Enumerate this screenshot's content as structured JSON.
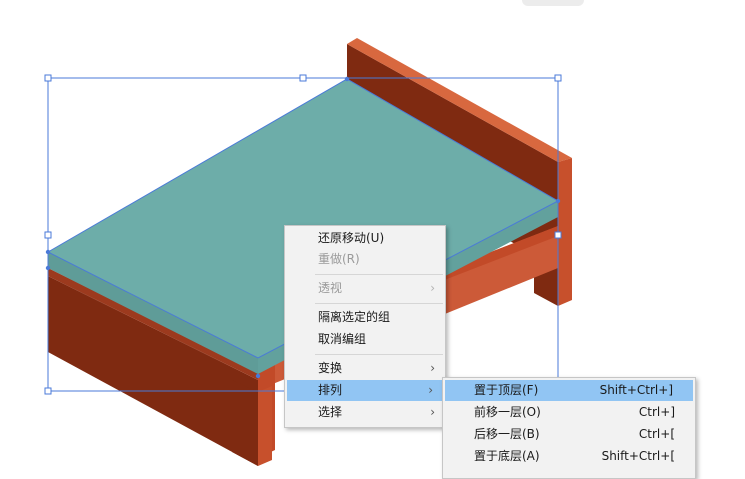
{
  "context_menu": {
    "items": [
      {
        "label": "还原移动(U)",
        "enabled": true
      },
      {
        "label": "重做(R)",
        "enabled": false
      },
      {
        "label": "透视",
        "enabled": false,
        "has_submenu": true
      },
      {
        "label": "隔离选定的组",
        "enabled": true
      },
      {
        "label": "取消编组",
        "enabled": true
      },
      {
        "label": "变换",
        "enabled": true,
        "has_submenu": true
      },
      {
        "label": "排列",
        "enabled": true,
        "has_submenu": true,
        "highlighted": true
      },
      {
        "label": "选择",
        "enabled": true,
        "has_submenu": true
      }
    ],
    "submenu_arrow": "›"
  },
  "arrange_submenu": {
    "items": [
      {
        "label": "置于顶层(F)",
        "shortcut": "Shift+Ctrl+]",
        "highlighted": true
      },
      {
        "label": "前移一层(O)",
        "shortcut": "Ctrl+]"
      },
      {
        "label": "后移一层(B)",
        "shortcut": "Ctrl+["
      },
      {
        "label": "置于底层(A)",
        "shortcut": "Shift+Ctrl+["
      }
    ]
  },
  "colors": {
    "mattress_top": "#6dada9",
    "mattress_side": "#5f9c98",
    "frame_light": "#cc5a38",
    "frame_mid": "#c24a28",
    "frame_dark": "#7f2a11",
    "selection": "#4a7ad8",
    "menu_bg": "#f2f2f2",
    "menu_highlight": "#91c5f3"
  }
}
